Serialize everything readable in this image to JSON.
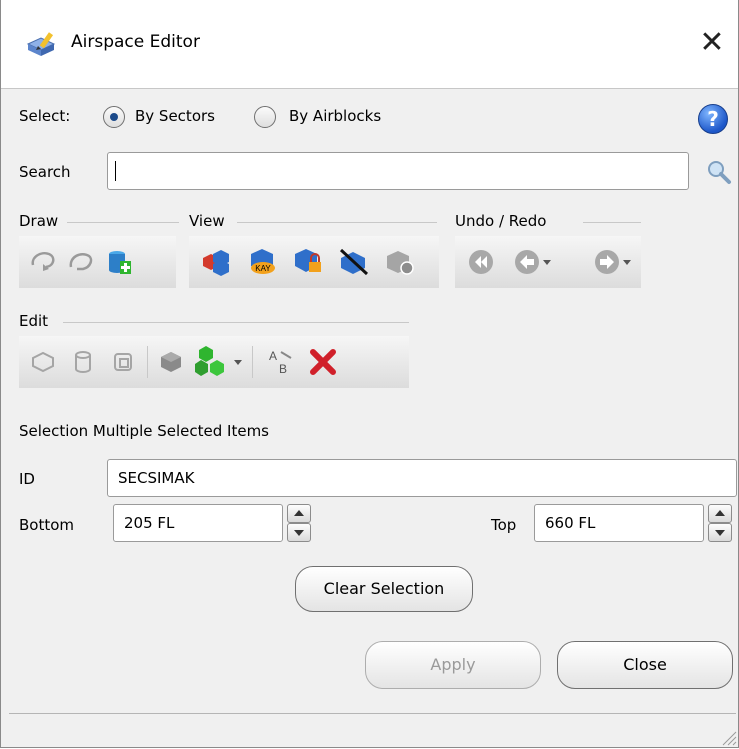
{
  "window": {
    "title": "Airspace Editor"
  },
  "select": {
    "label": "Select:",
    "options": [
      {
        "label": "By Sectors",
        "checked": true
      },
      {
        "label": "By Airblocks",
        "checked": false
      }
    ]
  },
  "search": {
    "label": "Search",
    "value": ""
  },
  "groups": {
    "draw": "Draw",
    "view": "View",
    "undo_redo": "Undo / Redo",
    "edit": "Edit"
  },
  "view_icon_badge": "KAY",
  "rename_icon_letters": {
    "a": "A",
    "b": "B"
  },
  "selection": {
    "label": "Selection Multiple Selected Items"
  },
  "fields": {
    "id": {
      "label": "ID",
      "value": "SECSIMAK"
    },
    "bottom": {
      "label": "Bottom",
      "value": "205 FL"
    },
    "top": {
      "label": "Top",
      "value": "660 FL"
    }
  },
  "buttons": {
    "clear_selection": "Clear Selection",
    "apply": "Apply",
    "close": "Close"
  },
  "icons": [
    "airspace-editor-icon",
    "close-icon",
    "help-icon",
    "search-icon",
    "draw-lasso-icon",
    "draw-freehand-icon",
    "add-volume-icon",
    "view-sectors-icon",
    "view-kay-icon",
    "view-locked-icon",
    "hide-icon",
    "view-gray-icon",
    "rewind-icon",
    "undo-icon",
    "redo-icon",
    "edit-shape-icon",
    "edit-volume-icon",
    "edit-group-icon",
    "edit-merge-icon",
    "add-blocks-icon",
    "rename-icon",
    "delete-icon",
    "resize-grip-icon"
  ],
  "colors": {
    "accent_blue": "#1c4a8a",
    "delete_red": "#d0202a",
    "green": "#2fb52f",
    "orange": "#f2a11c"
  }
}
